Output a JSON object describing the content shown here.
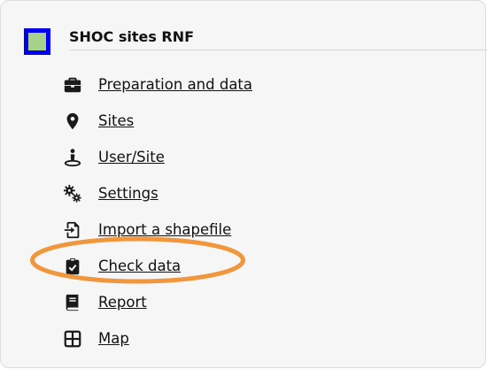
{
  "header": {
    "title": "SHOC sites RNF",
    "icon_border_color": "#0000ee",
    "icon_fill_color": "#a8d08d"
  },
  "menu": {
    "items": [
      {
        "label": "Preparation and data",
        "icon": "briefcase-icon"
      },
      {
        "label": "Sites",
        "icon": "map-pin-icon"
      },
      {
        "label": "User/Site",
        "icon": "user-location-icon"
      },
      {
        "label": "Settings",
        "icon": "gears-icon"
      },
      {
        "label": "Import a shapefile",
        "icon": "file-import-icon"
      },
      {
        "label": "Check data",
        "icon": "clipboard-check-icon",
        "highlighted": true
      },
      {
        "label": "Report",
        "icon": "book-icon"
      },
      {
        "label": "Map",
        "icon": "grid-map-icon"
      }
    ]
  },
  "highlight": {
    "color": "#f0963c",
    "target": "Check data"
  }
}
